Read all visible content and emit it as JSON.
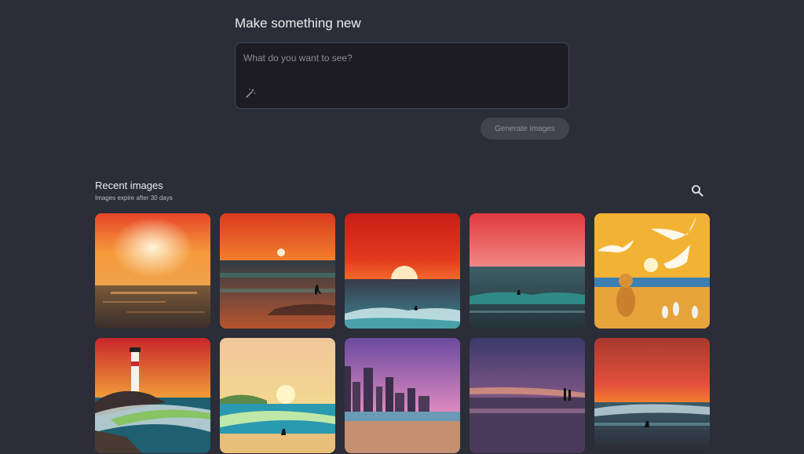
{
  "create": {
    "title": "Make something new",
    "prompt_placeholder": "What do you want to see?",
    "prompt_value": "",
    "generate_label": "Generate images"
  },
  "recent": {
    "title": "Recent images",
    "subtitle": "Images expire after 30 days"
  },
  "icons": {
    "prompt_tool": "magic-wand-icon",
    "search": "search-icon"
  },
  "colors": {
    "background": "#2b2d38",
    "prompt_box": "#1c1c22",
    "button_disabled": "#41434e"
  }
}
